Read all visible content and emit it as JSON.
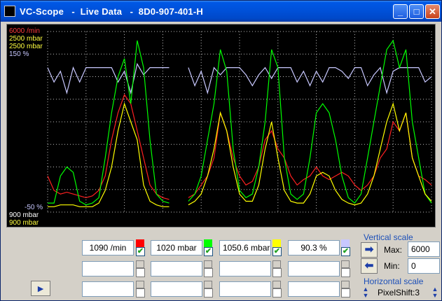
{
  "window": {
    "title": "VC-Scope   -  Live Data   -  8D0-907-401-H"
  },
  "titlebar_buttons": {
    "minimize": "_",
    "maximize": "□",
    "close": "✕"
  },
  "axis_labels": {
    "top": [
      "6000 /min",
      "2500 mbar",
      "2500 mbar",
      "150 %"
    ],
    "bottom": [
      "-50 %",
      "900 mbar",
      "900 mbar"
    ],
    "top_colors": [
      "#ff3b3b",
      "#ffff40",
      "#ffff40",
      "#c8c8ff"
    ],
    "bottom_colors": [
      "#c8c8ff",
      "#ffffff",
      "#ffff40"
    ]
  },
  "channels": [
    {
      "value": "1090 /min",
      "color": "#ff0000",
      "checked": true
    },
    {
      "value": "1020 mbar",
      "color": "#00ff00",
      "checked": true
    },
    {
      "value": "1050.6 mbar",
      "color": "#ffff00",
      "checked": true
    },
    {
      "value": "90.3 %",
      "color": "#c8c8ff",
      "checked": true
    }
  ],
  "vertical_scale": {
    "label": "Vertical scale",
    "max_label": "Max:",
    "max_value": "6000",
    "min_label": "Min:",
    "min_value": "0"
  },
  "horizontal_scale": {
    "label": "Horizontal scale",
    "pixel_shift": "PixelShift:3"
  },
  "icons": {
    "play": "play-arrow-icon",
    "right": "arrow-right-icon",
    "left": "arrow-left-icon"
  },
  "chart_data": {
    "type": "line",
    "series": [
      {
        "name": "1090 /min",
        "color": "#ff2020"
      },
      {
        "name": "1020 mbar",
        "color": "#00ff00"
      },
      {
        "name": "1050.6 mbar",
        "color": "#ffff00"
      },
      {
        "name": "90.3 %",
        "color": "#c8c8ff"
      }
    ],
    "x_points": 61,
    "green": [
      0.05,
      0.05,
      0.2,
      0.25,
      0.22,
      0.06,
      0.04,
      0.05,
      0.08,
      0.3,
      0.55,
      0.75,
      0.85,
      0.6,
      0.95,
      0.8,
      0.4,
      0.1,
      0.06,
      0.05,
      null,
      null,
      0.06,
      0.1,
      0.2,
      0.4,
      0.6,
      0.9,
      0.78,
      0.35,
      0.12,
      0.08,
      0.1,
      0.25,
      0.5,
      0.9,
      0.8,
      0.3,
      0.1,
      0.07,
      0.1,
      0.3,
      0.55,
      0.6,
      0.55,
      0.4,
      0.2,
      0.08,
      0.05,
      0.1,
      0.3,
      0.5,
      0.7,
      0.9,
      0.95,
      0.8,
      0.9,
      0.5,
      0.3,
      0.1,
      0.05
    ],
    "red": [
      0.2,
      0.12,
      0.1,
      0.11,
      0.1,
      0.09,
      0.08,
      0.09,
      0.12,
      0.2,
      0.4,
      0.55,
      0.65,
      0.6,
      0.45,
      0.3,
      0.15,
      0.1,
      0.08,
      0.07,
      null,
      null,
      0.08,
      0.1,
      0.15,
      0.2,
      0.3,
      0.55,
      0.45,
      0.3,
      0.2,
      0.15,
      0.17,
      0.25,
      0.4,
      0.45,
      0.35,
      0.3,
      0.2,
      0.15,
      0.18,
      0.2,
      0.25,
      0.2,
      0.18,
      0.2,
      0.22,
      0.2,
      0.15,
      0.12,
      0.15,
      0.2,
      0.3,
      0.35,
      0.5,
      0.45,
      0.55,
      0.3,
      0.2,
      0.18,
      0.15
    ],
    "yellow": [
      0.03,
      0.03,
      0.04,
      0.04,
      0.04,
      0.03,
      0.03,
      0.03,
      0.05,
      0.12,
      0.25,
      0.45,
      0.6,
      0.5,
      0.4,
      0.15,
      0.06,
      0.04,
      0.03,
      0.03,
      null,
      null,
      0.04,
      0.06,
      0.1,
      0.2,
      0.35,
      0.55,
      0.45,
      0.25,
      0.1,
      0.06,
      0.06,
      0.15,
      0.35,
      0.5,
      0.3,
      0.12,
      0.06,
      0.05,
      0.05,
      0.1,
      0.2,
      0.22,
      0.2,
      0.12,
      0.07,
      0.05,
      0.04,
      0.05,
      0.1,
      0.2,
      0.35,
      0.5,
      0.6,
      0.45,
      0.55,
      0.3,
      0.2,
      0.1,
      0.06
    ],
    "blue": [
      0.8,
      0.72,
      0.78,
      0.66,
      0.8,
      0.72,
      0.8,
      0.8,
      0.8,
      0.8,
      0.8,
      0.72,
      0.78,
      0.66,
      0.82,
      0.76,
      0.8,
      0.8,
      0.8,
      0.8,
      null,
      null,
      0.8,
      0.7,
      0.78,
      0.66,
      0.8,
      0.76,
      0.8,
      0.8,
      0.8,
      0.76,
      0.7,
      0.76,
      0.8,
      0.74,
      0.8,
      0.8,
      0.8,
      0.72,
      0.78,
      0.7,
      0.78,
      0.72,
      0.8,
      0.8,
      0.78,
      0.74,
      0.8,
      0.8,
      0.7,
      0.76,
      0.8,
      0.66,
      0.78,
      0.8,
      0.8,
      0.8,
      0.8,
      0.72,
      0.75
    ]
  }
}
